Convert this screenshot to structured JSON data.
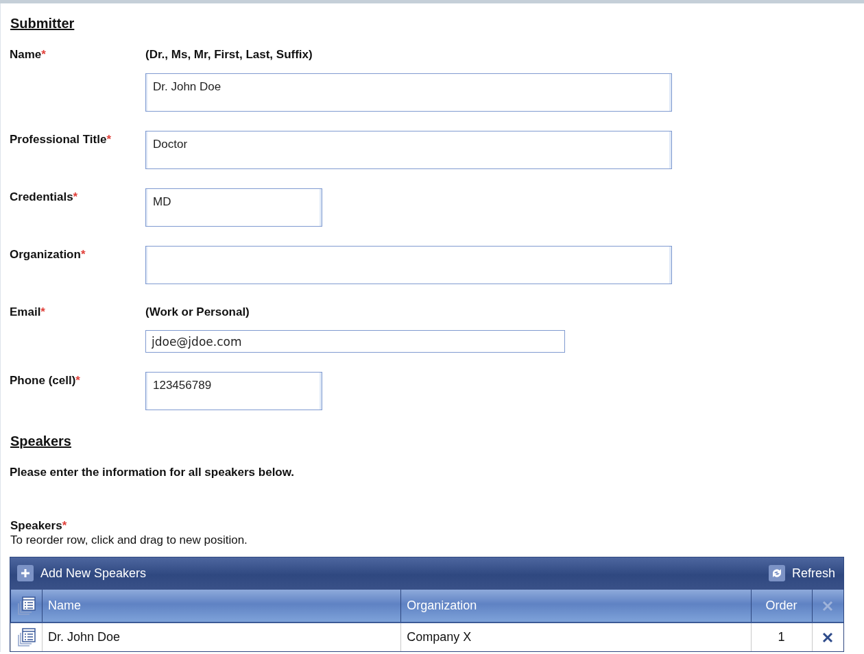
{
  "submitter": {
    "heading": "Submitter",
    "fields": [
      {
        "label": "Name",
        "mark": "*",
        "hint": "(Dr., Ms, Mr, First, Last, Suffix)",
        "kind": "long",
        "value": "Dr. John Doe"
      },
      {
        "label": "Professional Title",
        "mark": "*",
        "kind": "long",
        "value": "Doctor"
      },
      {
        "label": "Credentials",
        "mark": "*",
        "kind": "short",
        "value": "MD"
      },
      {
        "label": "Organization",
        "mark": "*",
        "kind": "long"
      },
      {
        "label": "Email",
        "mark": "*",
        "hint": "(Work or Personal)",
        "kind": "line",
        "value": "jdoe@jdoe.com"
      },
      {
        "label": "Phone (cell)",
        "mark": "*",
        "kind": "short",
        "value": "123456789"
      }
    ]
  },
  "speakers": {
    "heading": "Speakers",
    "intro": "Please enter the information for all speakers below.",
    "label": "Speakers",
    "mark": "*",
    "instruction": "To reorder row, click and drag to new position.",
    "grid": {
      "add_button": "Add New Speakers",
      "refresh_button": "Refresh",
      "columns": [
        "Name",
        "Organization",
        "Order"
      ],
      "rows": [
        {
          "name": "Dr. John Doe",
          "organization": "Company X",
          "order": "1"
        }
      ]
    }
  }
}
